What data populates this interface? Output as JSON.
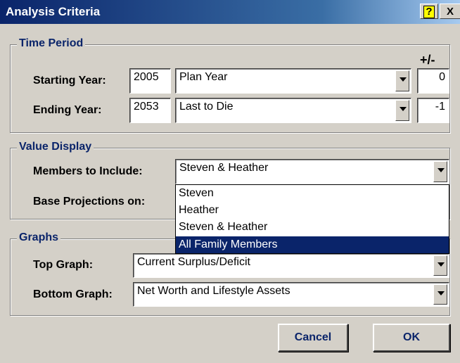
{
  "window": {
    "title": "Analysis Criteria",
    "help_label": "?",
    "close_label": "X"
  },
  "time_period": {
    "legend": "Time Period",
    "plus_minus_label": "+/-",
    "starting": {
      "label": "Starting Year:",
      "year": "2005",
      "basis": "Plan Year",
      "offset": "0"
    },
    "ending": {
      "label": "Ending Year:",
      "year": "2053",
      "basis": "Last to Die",
      "offset": "-1"
    }
  },
  "value_display": {
    "legend": "Value Display",
    "members_label": "Members to Include:",
    "members_value": "Steven & Heather",
    "base_label": "Base Projections on:",
    "options": [
      "Steven",
      "Heather",
      "Steven & Heather",
      "All Family Members"
    ],
    "highlighted_option": "All Family Members"
  },
  "graphs": {
    "legend": "Graphs",
    "top_label": "Top Graph:",
    "top_value": "Current Surplus/Deficit",
    "bottom_label": "Bottom Graph:",
    "bottom_value": "Net Worth and Lifestyle Assets"
  },
  "buttons": {
    "cancel": "Cancel",
    "ok": "OK"
  },
  "colors": {
    "accent": "#0a246a",
    "face": "#d4d0c8",
    "highlight": "#0a246a"
  }
}
